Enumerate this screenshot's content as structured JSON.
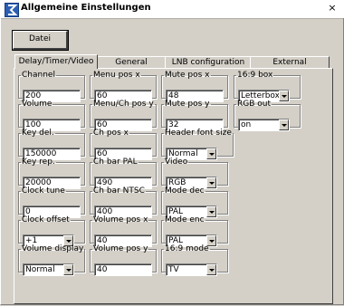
{
  "window": {
    "title": "Allgemeine Einstellungen",
    "close_glyph": "×"
  },
  "toolbar": {
    "file_label": "Datei"
  },
  "tabs": [
    {
      "label": "Delay/Timer/Video",
      "active": true
    },
    {
      "label": "General",
      "active": false
    },
    {
      "label": "LNB configuration",
      "active": false
    },
    {
      "label": "External",
      "active": false
    }
  ],
  "fields": {
    "channel": {
      "label": "Channel",
      "value": "200"
    },
    "volume": {
      "label": "Volume",
      "value": "100"
    },
    "key_del": {
      "label": "Key del.",
      "value": "150000"
    },
    "key_rep": {
      "label": "Key rep.",
      "value": "20000"
    },
    "clock_tune": {
      "label": "Clock tune",
      "value": "0"
    },
    "clock_offset": {
      "label": "Clock offset",
      "value": "+1"
    },
    "volume_display": {
      "label": "Volume display",
      "value": "Normal"
    },
    "menu_pos_x": {
      "label": "Menu pos x",
      "value": "60"
    },
    "menu_ch_pos_y": {
      "label": "Menu/Ch pos y",
      "value": "60"
    },
    "ch_pos_x": {
      "label": "Ch pos x",
      "value": "60"
    },
    "ch_bar_pal": {
      "label": "Ch bar PAL",
      "value": "490"
    },
    "ch_bar_ntsc": {
      "label": "Ch bar NTSC",
      "value": "400"
    },
    "volume_pos_x": {
      "label": "Volume pos x",
      "value": "40"
    },
    "volume_pos_y": {
      "label": "Volume pos y",
      "value": "40"
    },
    "mute_pos_x": {
      "label": "Mute pos x",
      "value": "48"
    },
    "mute_pos_y": {
      "label": "Mute pos y",
      "value": "32"
    },
    "header_font_size": {
      "label": "Header font size",
      "value": "Normal"
    },
    "video": {
      "label": "Video",
      "value": "RGB"
    },
    "mode_dec": {
      "label": "Mode dec",
      "value": "PAL"
    },
    "mode_enc": {
      "label": "Mode enc",
      "value": "PAL"
    },
    "mode_169": {
      "label": "16:9 mode",
      "value": "TV"
    },
    "box_169": {
      "label": "16:9 box",
      "value": "Letterbox"
    },
    "rgb_out": {
      "label": "RGB out",
      "value": "on"
    }
  },
  "icons": {
    "app": "app-icon",
    "dropdown": "chevron-down-icon"
  }
}
